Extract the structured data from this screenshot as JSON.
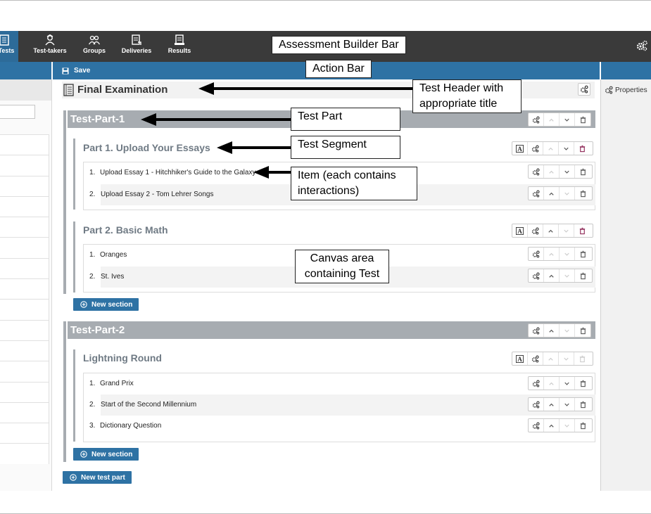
{
  "nav": {
    "items": [
      {
        "label": "Tests",
        "icon": "tests-icon",
        "active": true
      },
      {
        "label": "Test-takers",
        "icon": "test-takers-icon"
      },
      {
        "label": "Groups",
        "icon": "groups-icon"
      },
      {
        "label": "Deliveries",
        "icon": "deliveries-icon"
      },
      {
        "label": "Results",
        "icon": "results-icon"
      }
    ],
    "settings_icon": "gears-icon"
  },
  "action_bar": {
    "save_label": "Save",
    "save_icon": "floppy-disk-icon"
  },
  "right_panel": {
    "properties_label": "Properties",
    "properties_icon": "gears-icon"
  },
  "test": {
    "title": "Final Examination",
    "parts": [
      {
        "title": "Test-Part-1",
        "sections": [
          {
            "title": "Part 1. Upload Your Essays",
            "items": [
              {
                "num": "1.",
                "label": "Upload Essay 1 - Hitchhiker's Guide to the Galaxy"
              },
              {
                "num": "2.",
                "label": "Upload Essay 2 - Tom Lehrer Songs"
              }
            ]
          },
          {
            "title": "Part 2. Basic Math",
            "items": [
              {
                "num": "1.",
                "label": "Oranges"
              },
              {
                "num": "2.",
                "label": "St. Ives"
              }
            ]
          }
        ],
        "new_section_label": "New section"
      },
      {
        "title": "Test-Part-2",
        "sections": [
          {
            "title": "Lightning Round",
            "items": [
              {
                "num": "1.",
                "label": "Grand Prix"
              },
              {
                "num": "2.",
                "label": "Start of the Second Millennium"
              },
              {
                "num": "3.",
                "label": "Dictionary Question"
              }
            ]
          }
        ],
        "new_section_label": "New section"
      }
    ],
    "new_test_part_label": "New test part"
  },
  "annotations": {
    "builder_bar": "Assessment Builder Bar",
    "action_bar": "Action Bar",
    "test_header_line1": "Test Header with",
    "test_header_line2": "appropriate title",
    "test_part": "Test Part",
    "test_segment": "Test Segment",
    "item_line1": "Item (each contains",
    "item_line2": "interactions)",
    "canvas_line1": "Canvas area",
    "canvas_line2": "containing Test"
  },
  "colors": {
    "nav_bg": "#3a3a3a",
    "nav_active": "#2d6b99",
    "action_bar": "#2e72a4",
    "part_bar": "#a7acb1",
    "section_title": "#6f7a84",
    "delete_icon": "#8b2252"
  }
}
